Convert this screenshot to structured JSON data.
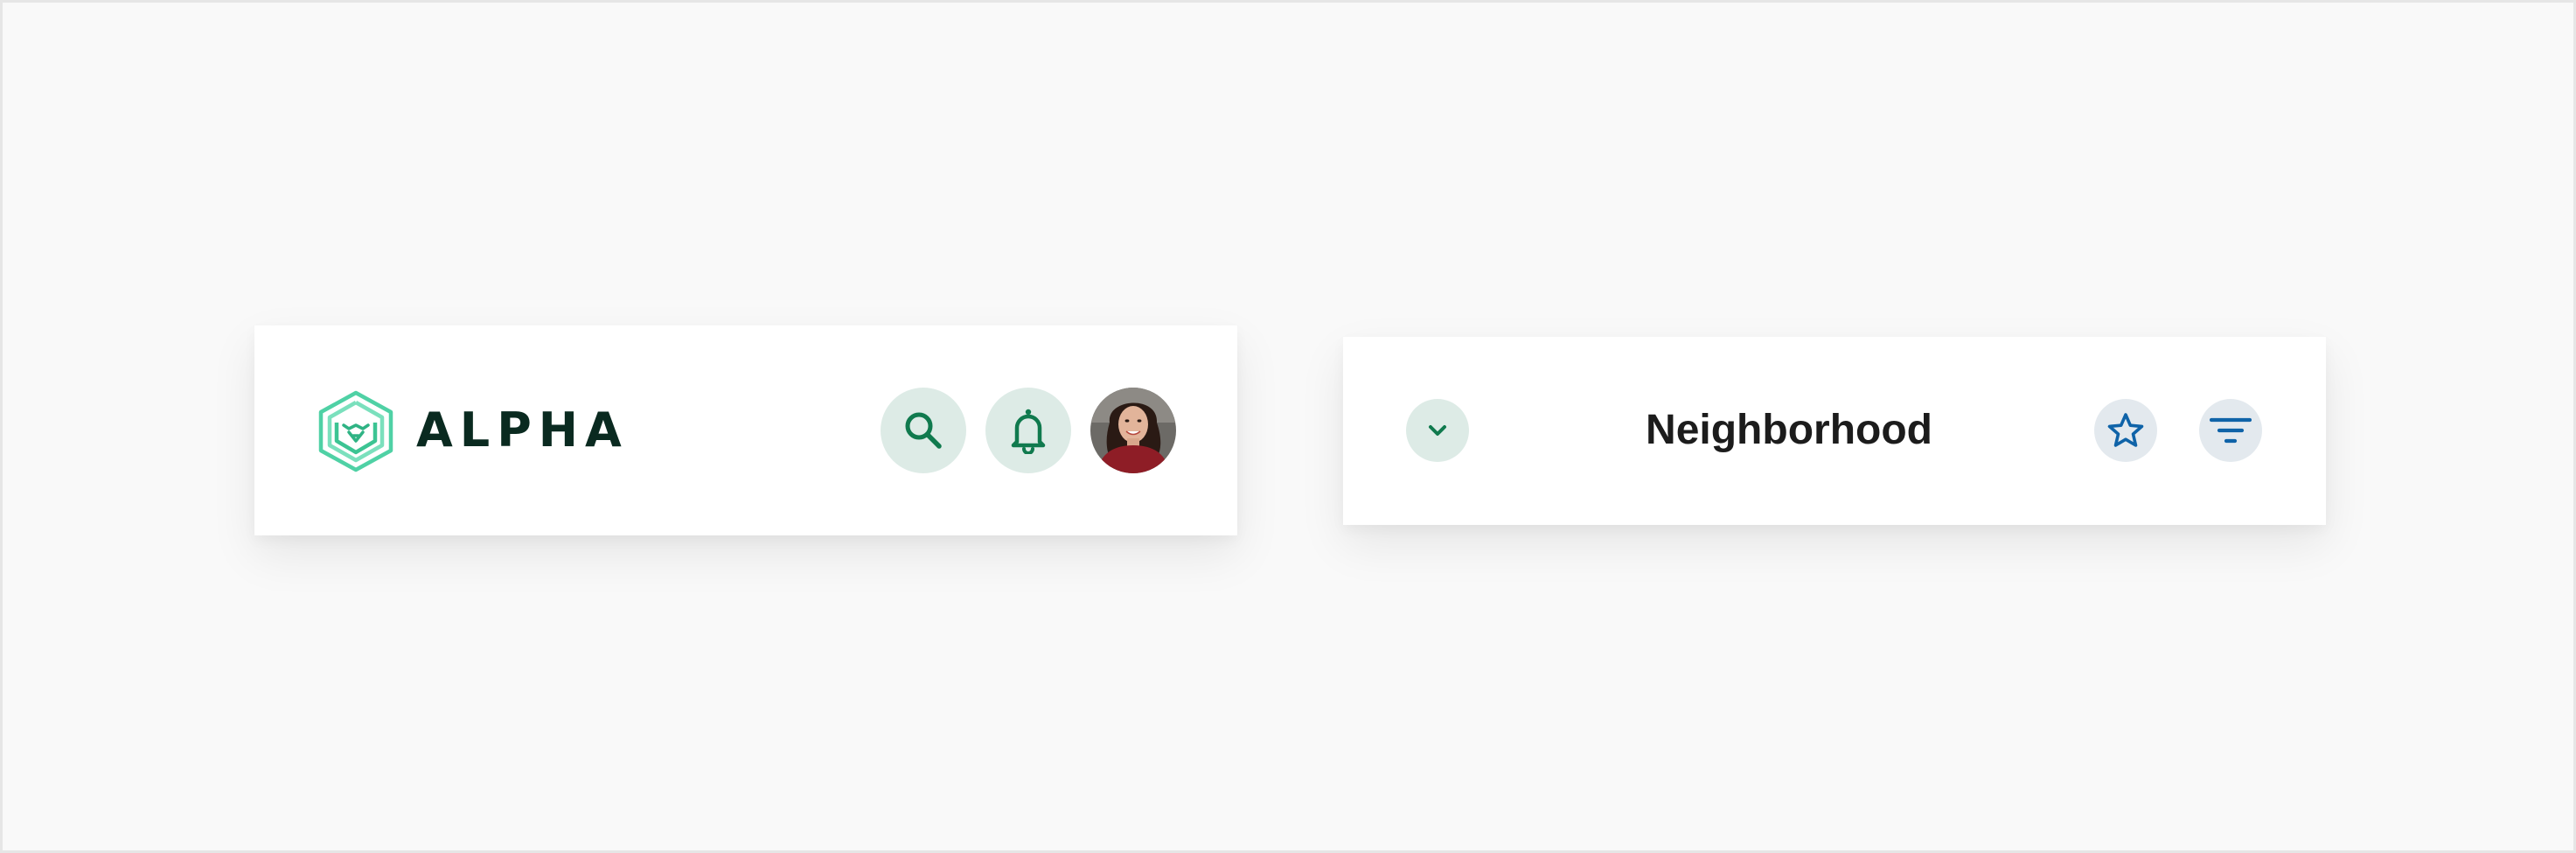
{
  "app_header": {
    "brand_name": "ALPHA",
    "logo_icon": "hexagon-lion-logo",
    "search_icon": "search-icon",
    "notifications_icon": "bell-icon",
    "avatar_icon": "user-avatar"
  },
  "page_header": {
    "title": "Neighborhood",
    "collapse_icon": "chevron-down-icon",
    "favorite_icon": "star-icon",
    "filter_icon": "filter-icon"
  },
  "colors": {
    "background": "#f9f9f9",
    "card": "#ffffff",
    "brand_dark": "#0a2a20",
    "logo_green": "#4fd1a5",
    "icon_green": "#107a4e",
    "icon_blue": "#0f63a8",
    "green_tint": "#ddebe6",
    "blue_tint": "#e3e9ee",
    "title_text": "#1c1c1c"
  }
}
